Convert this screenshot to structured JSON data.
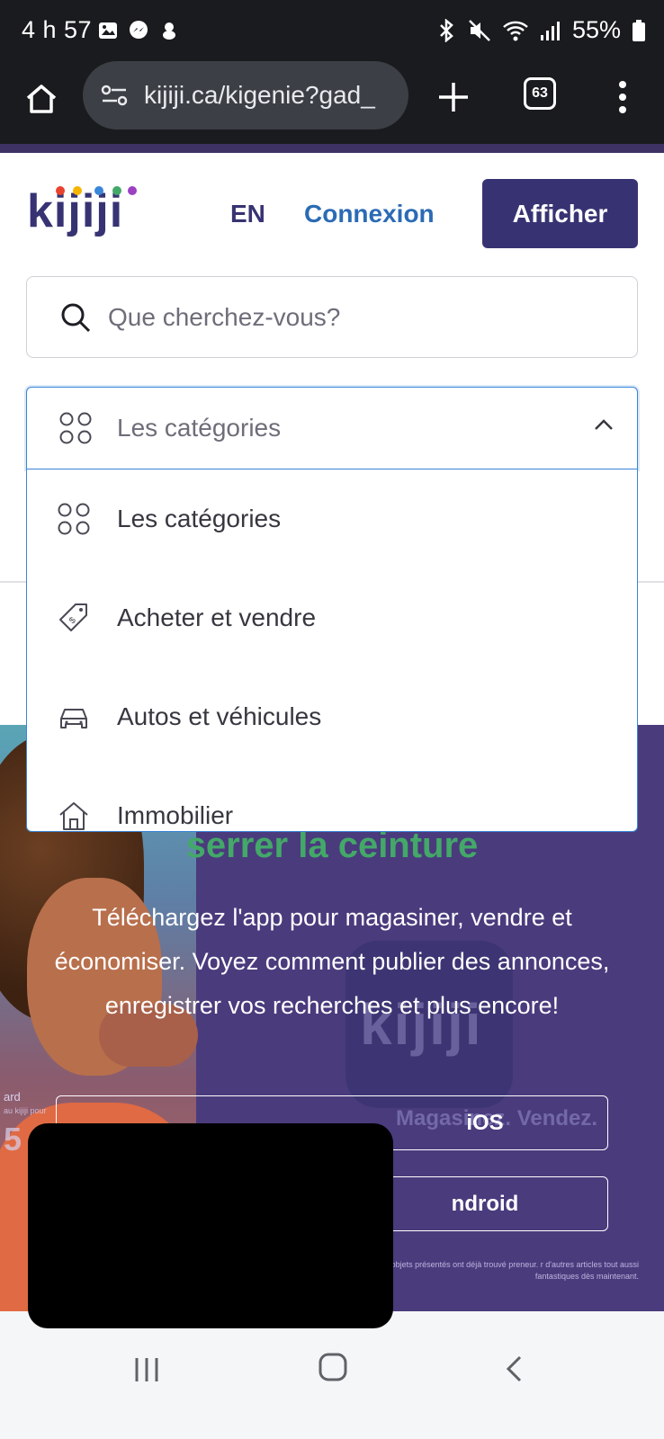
{
  "status_bar": {
    "time": "4 h 57",
    "battery": "55%"
  },
  "browser": {
    "url": "kijiji.ca/kigenie?gad_",
    "tab_count": "63"
  },
  "header": {
    "lang_label": "EN",
    "login_label": "Connexion",
    "post_button_label": "Afficher"
  },
  "search": {
    "placeholder": "Que cherchez-vous?"
  },
  "category_select": {
    "selected": "Les catégories",
    "options": [
      {
        "label": "Les catégories",
        "icon": "grid-icon"
      },
      {
        "label": "Acheter et vendre",
        "icon": "price-tag-icon"
      },
      {
        "label": "Autos et véhicules",
        "icon": "car-icon"
      },
      {
        "label": "Immobilier",
        "icon": "house-icon"
      }
    ]
  },
  "hero": {
    "heading": "serrer la ceinture",
    "body": "Téléchargez l'app pour magasiner, vendre et économiser. Voyez comment publier des annonces, enregistrer vos recherches et plus encore!",
    "ios_button": "iOS",
    "android_button": "ndroid",
    "background_tagline": "Magasinez. Vendez.",
    "photo_caption": "ard",
    "photo_subcaption": "au kijiji pour",
    "photo_price": "5 $",
    "app_tile_text": "kijiji",
    "fine_print": "us les jours. Les objets présentés ont déjà trouvé preneur. r d'autres articles tout aussi fantastiques dès maintenant."
  },
  "colors": {
    "brand_purple": "#373373",
    "link_blue": "#2b6bb5",
    "focus_blue": "#3a86d8",
    "hero_purple": "#4a3b7d",
    "hero_green": "#43a868"
  }
}
